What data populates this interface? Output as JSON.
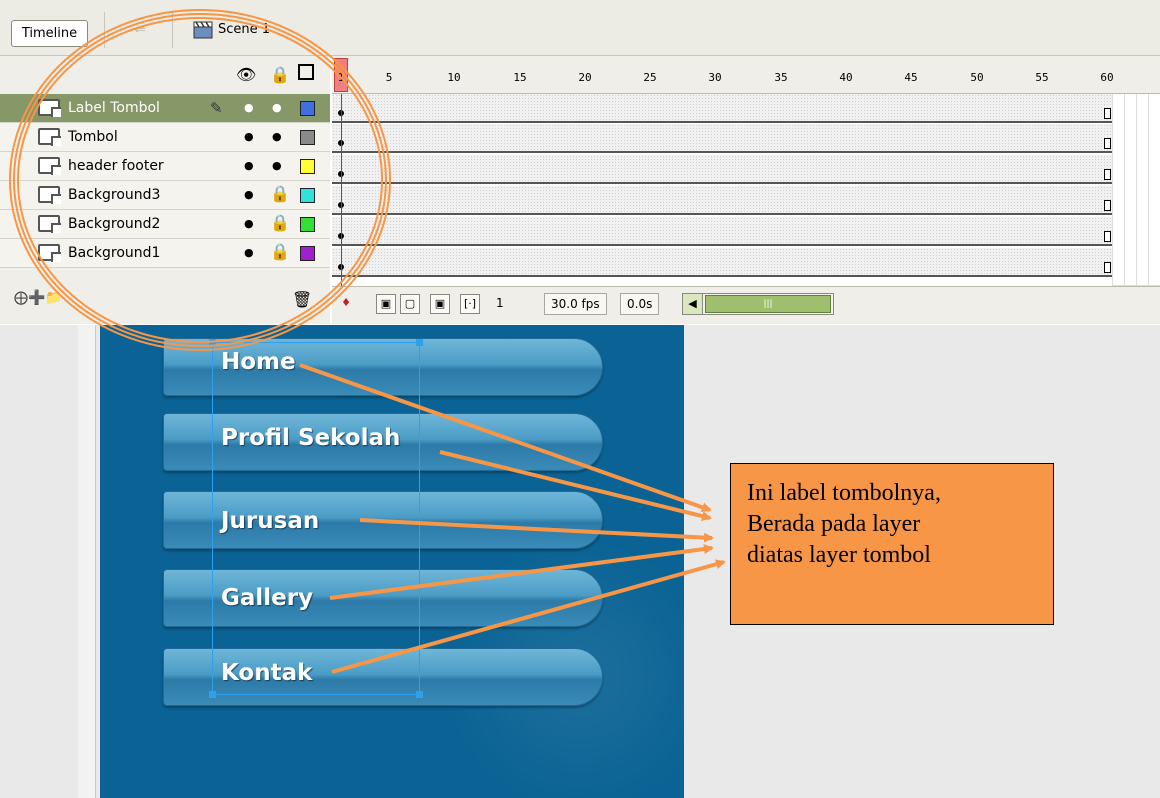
{
  "tabs": {
    "timeline": "Timeline",
    "scene": "Scene 1"
  },
  "layers": [
    {
      "name": "Label Tombol",
      "selected": true,
      "locked": false,
      "color": "#3f6fe0"
    },
    {
      "name": "Tombol",
      "selected": false,
      "locked": false,
      "color": "#8a8a8a"
    },
    {
      "name": "header footer",
      "selected": false,
      "locked": false,
      "color": "#ffff33"
    },
    {
      "name": "Background3",
      "selected": false,
      "locked": true,
      "color": "#33e0e0"
    },
    {
      "name": "Background2",
      "selected": false,
      "locked": true,
      "color": "#33e033"
    },
    {
      "name": "Background1",
      "selected": false,
      "locked": true,
      "color": "#a020d0"
    }
  ],
  "ruler": {
    "numbers": [
      "1",
      "5",
      "10",
      "15",
      "20",
      "25",
      "30",
      "35",
      "40",
      "45",
      "50",
      "55",
      "60"
    ]
  },
  "frames_footer": {
    "current_frame": "1",
    "fps": "30.0 fps",
    "time": "0.0s"
  },
  "menu": [
    "Home",
    "Profil Sekolah",
    "Jurusan",
    "Gallery",
    "Kontak"
  ],
  "callout": {
    "line1": "Ini label tombolnya,",
    "line2": "Berada pada layer",
    "line3": "diatas layer tombol"
  },
  "colors": {
    "annotation": "#f79646",
    "stage": "#0a6394",
    "selection": "#879868"
  }
}
